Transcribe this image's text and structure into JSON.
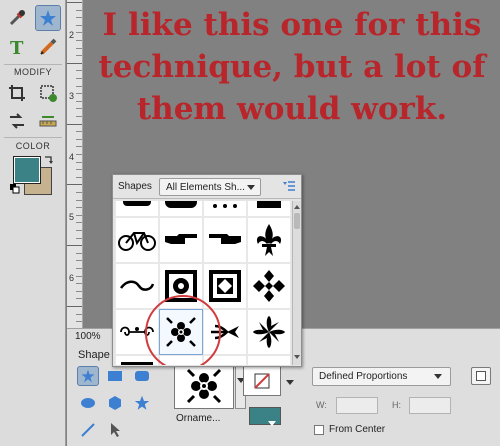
{
  "annotation": {
    "line1": "I like this one for this",
    "line2": "technique, but a lot of",
    "line3": "them would work."
  },
  "toolbox": {
    "modify_label": "MODIFY",
    "color_label": "COLOR",
    "foreground_color": "#3a8286",
    "background_color": "#c7b28f"
  },
  "ruler": {
    "numbers": [
      "2",
      "3",
      "4",
      "5",
      "6"
    ]
  },
  "shapes_panel": {
    "title": "Shapes",
    "dropdown_value": "All Elements Sh..."
  },
  "options_bar": {
    "zoom": "100%",
    "label": "Shape",
    "shape_name": "Orname...",
    "constraint_value": "Defined Proportions",
    "w_label": "W:",
    "h_label": "H:",
    "from_center_label": "From Center",
    "shape_color": "#3a8286"
  },
  "colors": {
    "annotation": "#b8252a",
    "highlight_circle": "#d03b3e",
    "selected_tool": "#9fb6cf"
  }
}
